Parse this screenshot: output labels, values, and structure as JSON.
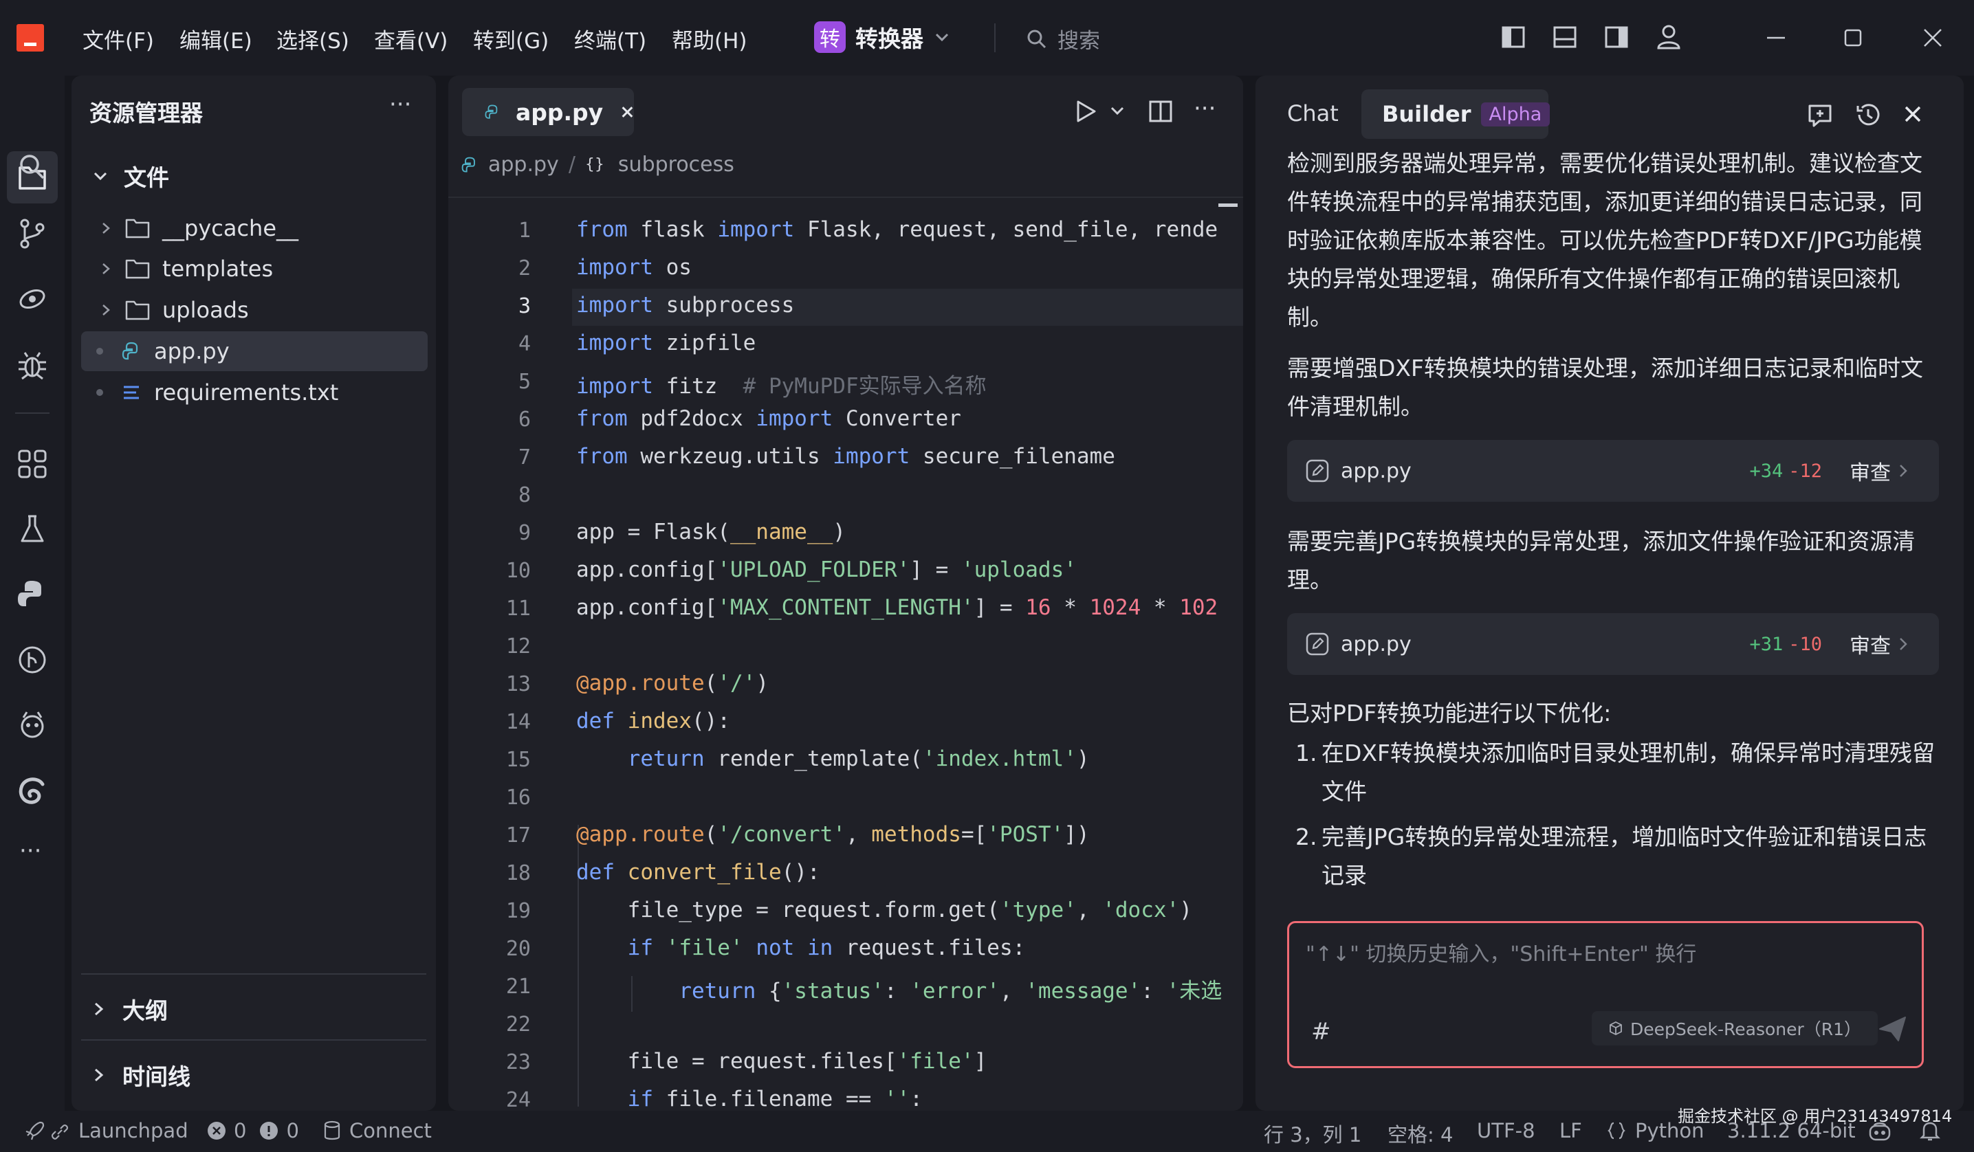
{
  "menu": [
    "文件(F)",
    "编辑(E)",
    "选择(S)",
    "查看(V)",
    "转到(G)",
    "终端(T)",
    "帮助(H)"
  ],
  "project": {
    "badge": "转",
    "name": "转换器"
  },
  "search": {
    "placeholder": "搜索"
  },
  "explorer": {
    "title": "资源管理器",
    "more": "···",
    "section": "文件",
    "items": [
      {
        "label": "__pycache__",
        "type": "folder"
      },
      {
        "label": "templates",
        "type": "folder"
      },
      {
        "label": "uploads",
        "type": "folder"
      },
      {
        "label": "app.py",
        "type": "python",
        "selected": true
      },
      {
        "label": "requirements.txt",
        "type": "text"
      }
    ],
    "outline": "大纲",
    "timeline": "时间线"
  },
  "editor": {
    "tab": "app.py",
    "breadcrumb_file": "app.py",
    "breadcrumb_sep": "/",
    "breadcrumb_symbol_icon": "{}",
    "breadcrumb_symbol": "subprocess",
    "current_line": 3,
    "line_numbers": [
      "1",
      "2",
      "3",
      "4",
      "5",
      "6",
      "7",
      "8",
      "9",
      "10",
      "11",
      "12",
      "13",
      "14",
      "15",
      "16",
      "17",
      "18",
      "19",
      "20",
      "21",
      "22",
      "23",
      "24"
    ]
  },
  "chat": {
    "tabs": {
      "chat": "Chat",
      "builder": "Builder",
      "builder_badge": "Alpha"
    },
    "message1": "检测到服务器端处理异常，需要优化错误处理机制。建议检查文件转换流程中的异常捕获范围，添加更详细的错误日志记录，同时验证依赖库版本兼容性。可以优先检查PDF转DXF/JPG功能模块的异常处理逻辑，确保所有文件操作都有正确的错误回滚机制。",
    "message2": "需要增强DXF转换模块的错误处理，添加详细日志记录和临时文件清理机制。",
    "card1": {
      "file": "app.py",
      "added": "+34",
      "removed": "-12",
      "action": "审查"
    },
    "message3": "需要完善JPG转换模块的异常处理，添加文件操作验证和资源清理。",
    "card2": {
      "file": "app.py",
      "added": "+31",
      "removed": "-10",
      "action": "审查"
    },
    "summary_title": "已对PDF转换功能进行以下优化:",
    "summary_items": [
      {
        "num": "1.",
        "text": "在DXF转换模块添加临时目录处理机制，确保异常时清理残留文件"
      },
      {
        "num": "2.",
        "text": "完善JPG转换的异常处理流程，增加临时文件验证和错误日志记录"
      }
    ],
    "input_placeholder": "\"↑↓\" 切换历史输入，\"Shift+Enter\" 换行",
    "hash": "#",
    "model": "DeepSeek-Reasoner（R1）"
  },
  "status": {
    "launchpad": "Launchpad",
    "errors": "0",
    "warnings": "0",
    "connect": "Connect",
    "position": "行 3，列 1",
    "spaces": "空格: 4",
    "encoding": "UTF-8",
    "eol": "LF",
    "language": "Python",
    "interpreter": "3.11.2 64-bit",
    "watermark": "掘金技术社区 @ 用户23143497814"
  },
  "colors": {
    "accent_red": "#f2442b",
    "badge_purple": "#9b4de1",
    "diff_add": "#55c27d",
    "diff_del": "#ee6b6b",
    "input_border": "#f06b74"
  }
}
